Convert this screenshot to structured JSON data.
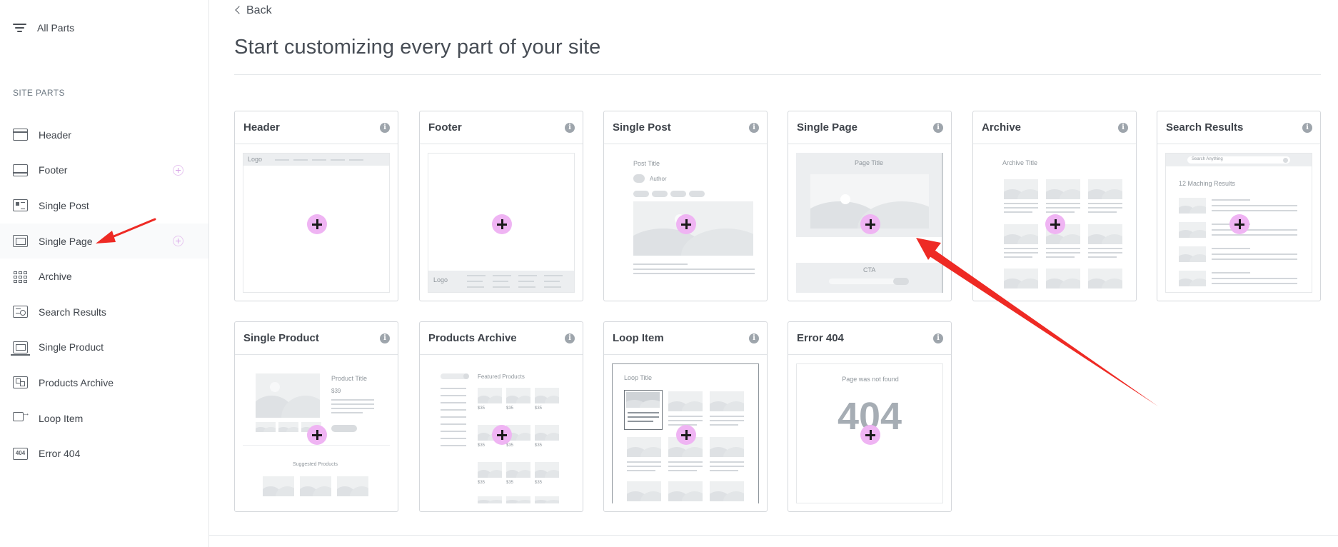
{
  "sidebar": {
    "all_parts_label": "All Parts",
    "section_title": "SITE PARTS",
    "items": [
      {
        "label": "Header",
        "icon": "header-icon",
        "has_add": false
      },
      {
        "label": "Footer",
        "icon": "footer-icon",
        "has_add": true
      },
      {
        "label": "Single Post",
        "icon": "single-post-icon",
        "has_add": false
      },
      {
        "label": "Single Page",
        "icon": "single-page-icon",
        "has_add": true
      },
      {
        "label": "Archive",
        "icon": "archive-icon",
        "has_add": false
      },
      {
        "label": "Search Results",
        "icon": "search-results-icon",
        "has_add": false
      },
      {
        "label": "Single Product",
        "icon": "single-product-icon",
        "has_add": false
      },
      {
        "label": "Products Archive",
        "icon": "products-archive-icon",
        "has_add": false
      },
      {
        "label": "Loop Item",
        "icon": "loop-item-icon",
        "has_add": false
      },
      {
        "label": "Error 404",
        "icon": "error-404-icon",
        "has_add": false
      }
    ]
  },
  "main": {
    "back_label": "Back",
    "title": "Start customizing every part of your site",
    "cards": [
      {
        "title": "Header"
      },
      {
        "title": "Footer"
      },
      {
        "title": "Single Post"
      },
      {
        "title": "Single Page"
      },
      {
        "title": "Archive"
      },
      {
        "title": "Search Results"
      },
      {
        "title": "Single Product"
      },
      {
        "title": "Products Archive"
      },
      {
        "title": "Loop Item"
      },
      {
        "title": "Error 404"
      }
    ],
    "info_glyph": "i"
  },
  "previews": {
    "header_logo": "Logo",
    "footer_logo": "Logo",
    "post_title": "Post Title",
    "post_author": "Author",
    "page_title": "Page Title",
    "page_cta": "CTA",
    "archive_title": "Archive Title",
    "search_placeholder": "Search Anything",
    "search_results": "12 Maching Results",
    "product_title": "Product Title",
    "product_price": "$39",
    "suggested_products": "Suggested Products",
    "featured_products": "Featured Products",
    "price_tag": "$35",
    "loop_title": "Loop Title",
    "error_message": "Page was not found",
    "error_code": "404"
  },
  "colors": {
    "accent_add": "#efb4f3",
    "annotation_arrow": "#ee2a24"
  }
}
